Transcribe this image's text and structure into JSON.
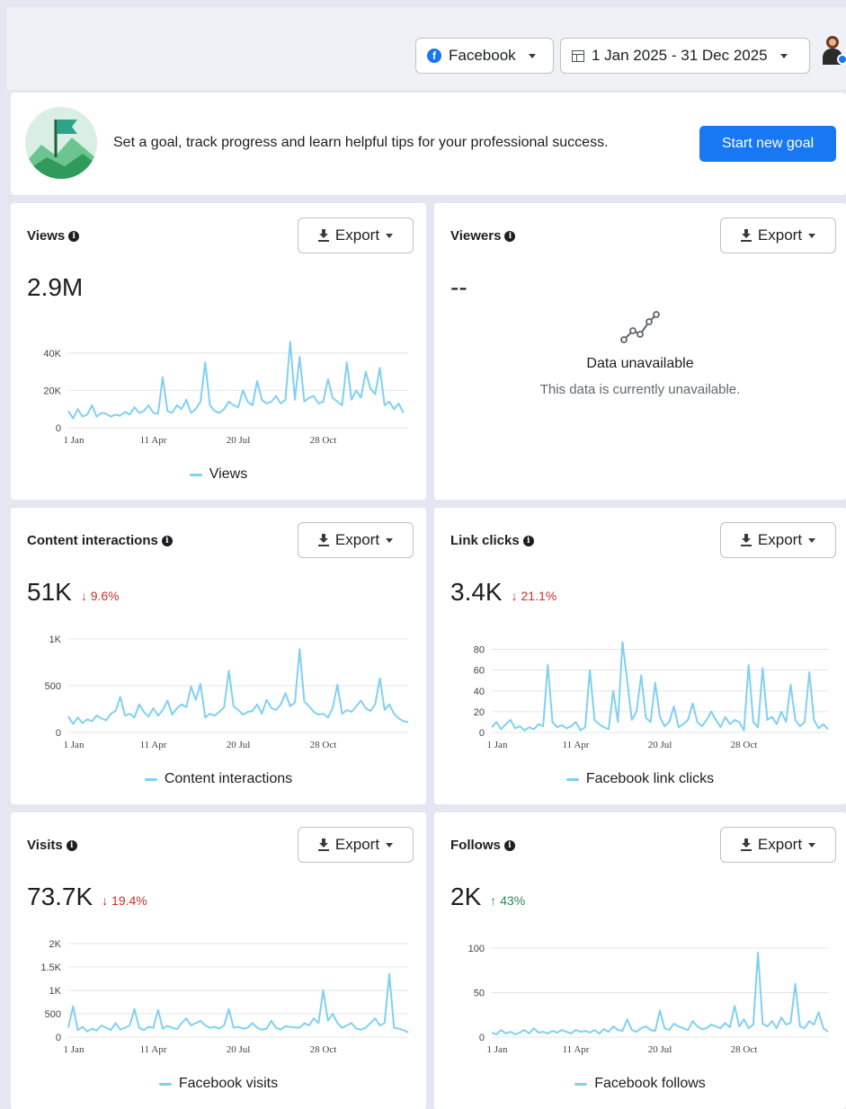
{
  "header": {
    "platform_select": "Facebook",
    "date_range": "1 Jan 2025 - 31 Dec 2025"
  },
  "banner": {
    "text": "Set a goal, track progress and learn helpful tips for your professional success.",
    "button": "Start new goal"
  },
  "export_label": "Export",
  "colors": {
    "accent": "#1877f2",
    "line": "#80d0f3",
    "negative": "#c9302c",
    "positive": "#2e8b57"
  },
  "cards": {
    "views": {
      "title": "Views",
      "value": "2.9M",
      "legend": "Views"
    },
    "viewers": {
      "title": "Viewers",
      "value": "--",
      "unavailable_title": "Data unavailable",
      "unavailable_sub": "This data is currently unavailable."
    },
    "content_interactions": {
      "title": "Content interactions",
      "value": "51K",
      "change": "↓ 9.6%",
      "legend": "Content interactions"
    },
    "link_clicks": {
      "title": "Link clicks",
      "value": "3.4K",
      "change": "↓ 21.1%",
      "legend": "Facebook link clicks"
    },
    "visits": {
      "title": "Visits",
      "value": "73.7K",
      "change": "↓ 19.4%",
      "legend": "Facebook visits"
    },
    "follows": {
      "title": "Follows",
      "value": "2K",
      "change": "↑ 43%",
      "legend": "Facebook follows"
    }
  },
  "chart_data": [
    {
      "id": "views",
      "type": "line",
      "series_name": "Views",
      "x_ticks": [
        "1 Jan",
        "11 Apr",
        "20 Jul",
        "28 Oct"
      ],
      "y_ticks": [
        "0",
        "20K",
        "40K"
      ],
      "ylim": [
        0,
        50000
      ],
      "x": [
        0,
        5,
        10,
        15,
        20,
        25,
        30,
        35,
        40,
        45,
        50,
        55,
        60,
        65,
        70,
        75,
        80,
        85,
        90,
        95,
        100,
        105,
        110,
        115,
        120,
        125,
        130,
        135,
        140,
        145,
        150,
        155,
        160,
        165,
        170,
        175,
        180,
        185,
        190,
        195,
        200,
        205,
        210,
        215,
        220,
        225,
        230,
        235,
        240,
        245,
        250,
        255,
        260,
        265,
        270,
        275,
        280,
        285,
        290,
        295,
        300,
        305,
        310,
        315,
        320,
        325,
        330,
        335,
        340,
        345,
        350,
        355,
        360
      ],
      "values": [
        9000,
        5000,
        10000,
        6000,
        7000,
        12000,
        6000,
        8000,
        7500,
        6000,
        7000,
        6500,
        8500,
        7000,
        11000,
        8000,
        9000,
        12000,
        8000,
        7500,
        27000,
        9000,
        8000,
        12000,
        10000,
        15000,
        8000,
        10000,
        14000,
        35000,
        12000,
        9000,
        8000,
        10000,
        14000,
        12000,
        11000,
        20000,
        14000,
        12000,
        25000,
        15000,
        13000,
        14000,
        17000,
        13000,
        15000,
        46000,
        15000,
        38000,
        14000,
        16000,
        17000,
        13000,
        14000,
        26000,
        16000,
        14000,
        12000,
        35000,
        15000,
        20000,
        16000,
        30000,
        21000,
        18000,
        32000,
        12000,
        14000,
        10000,
        13000,
        8000
      ]
    },
    {
      "id": "content_interactions",
      "type": "line",
      "series_name": "Content interactions",
      "x_ticks": [
        "1 Jan",
        "11 Apr",
        "20 Jul",
        "28 Oct"
      ],
      "y_ticks": [
        "0",
        "500",
        "1K"
      ],
      "ylim": [
        0,
        1000
      ],
      "x": [
        0,
        5,
        10,
        15,
        20,
        25,
        30,
        35,
        40,
        45,
        50,
        55,
        60,
        65,
        70,
        75,
        80,
        85,
        90,
        95,
        100,
        105,
        110,
        115,
        120,
        125,
        130,
        135,
        140,
        145,
        150,
        155,
        160,
        165,
        170,
        175,
        180,
        185,
        190,
        195,
        200,
        205,
        210,
        215,
        220,
        225,
        230,
        235,
        240,
        245,
        250,
        255,
        260,
        265,
        270,
        275,
        280,
        285,
        290,
        295,
        300,
        305,
        310,
        315,
        320,
        325,
        330,
        335,
        340,
        345,
        350,
        355,
        360
      ],
      "values": [
        170,
        90,
        160,
        100,
        140,
        120,
        180,
        150,
        130,
        200,
        230,
        380,
        180,
        200,
        160,
        300,
        220,
        170,
        260,
        180,
        240,
        340,
        190,
        260,
        300,
        270,
        490,
        350,
        520,
        160,
        200,
        180,
        220,
        270,
        660,
        280,
        240,
        190,
        220,
        230,
        300,
        200,
        350,
        260,
        240,
        300,
        420,
        280,
        320,
        890,
        330,
        280,
        220,
        190,
        200,
        160,
        260,
        510,
        200,
        240,
        220,
        280,
        340,
        260,
        230,
        300,
        580,
        240,
        300,
        200,
        150,
        120,
        110
      ]
    },
    {
      "id": "link_clicks",
      "type": "line",
      "series_name": "Facebook link clicks",
      "x_ticks": [
        "1 Jan",
        "11 Apr",
        "20 Jul",
        "28 Oct"
      ],
      "y_ticks": [
        "0",
        "20",
        "40",
        "60",
        "80"
      ],
      "ylim": [
        0,
        90
      ],
      "x": [
        0,
        5,
        10,
        15,
        20,
        25,
        30,
        35,
        40,
        45,
        50,
        55,
        60,
        65,
        70,
        75,
        80,
        85,
        90,
        95,
        100,
        105,
        110,
        115,
        120,
        125,
        130,
        135,
        140,
        145,
        150,
        155,
        160,
        165,
        170,
        175,
        180,
        185,
        190,
        195,
        200,
        205,
        210,
        215,
        220,
        225,
        230,
        235,
        240,
        245,
        250,
        255,
        260,
        265,
        270,
        275,
        280,
        285,
        290,
        295,
        300,
        305,
        310,
        315,
        320,
        325,
        330,
        335,
        340,
        345,
        350,
        355,
        360
      ],
      "values": [
        5,
        10,
        3,
        8,
        12,
        4,
        6,
        2,
        5,
        3,
        8,
        6,
        65,
        10,
        5,
        7,
        4,
        6,
        10,
        2,
        5,
        60,
        12,
        8,
        5,
        3,
        40,
        10,
        87,
        50,
        12,
        20,
        55,
        14,
        10,
        48,
        15,
        6,
        10,
        25,
        5,
        8,
        12,
        28,
        10,
        6,
        12,
        20,
        12,
        5,
        15,
        8,
        12,
        10,
        2,
        65,
        10,
        5,
        62,
        12,
        15,
        8,
        20,
        10,
        46,
        12,
        6,
        10,
        58,
        12,
        4,
        8,
        3
      ]
    },
    {
      "id": "visits",
      "type": "line",
      "series_name": "Facebook visits",
      "x_ticks": [
        "1 Jan",
        "11 Apr",
        "20 Jul",
        "28 Oct"
      ],
      "y_ticks": [
        "0",
        "500",
        "1K",
        "1.5K",
        "2K"
      ],
      "ylim": [
        0,
        2000
      ],
      "x": [
        0,
        5,
        10,
        15,
        20,
        25,
        30,
        35,
        40,
        45,
        50,
        55,
        60,
        65,
        70,
        75,
        80,
        85,
        90,
        95,
        100,
        105,
        110,
        115,
        120,
        125,
        130,
        135,
        140,
        145,
        150,
        155,
        160,
        165,
        170,
        175,
        180,
        185,
        190,
        195,
        200,
        205,
        210,
        215,
        220,
        225,
        230,
        235,
        240,
        245,
        250,
        255,
        260,
        265,
        270,
        275,
        280,
        285,
        290,
        295,
        300,
        305,
        310,
        315,
        320,
        325,
        330,
        335,
        340,
        345,
        350,
        355,
        360
      ],
      "values": [
        200,
        660,
        150,
        220,
        120,
        180,
        140,
        250,
        200,
        150,
        300,
        160,
        200,
        250,
        600,
        200,
        150,
        220,
        200,
        580,
        180,
        240,
        200,
        170,
        300,
        400,
        250,
        300,
        350,
        250,
        200,
        220,
        180,
        250,
        600,
        200,
        220,
        180,
        200,
        300,
        200,
        160,
        180,
        350,
        200,
        160,
        230,
        220,
        210,
        200,
        300,
        250,
        400,
        300,
        1000,
        350,
        500,
        300,
        200,
        250,
        300,
        180,
        160,
        200,
        300,
        400,
        250,
        300,
        1350,
        200,
        180,
        150,
        100
      ]
    },
    {
      "id": "follows",
      "type": "line",
      "series_name": "Facebook follows",
      "x_ticks": [
        "1 Jan",
        "11 Apr",
        "20 Jul",
        "28 Oct"
      ],
      "y_ticks": [
        "0",
        "50",
        "100"
      ],
      "ylim": [
        0,
        105
      ],
      "x": [
        0,
        5,
        10,
        15,
        20,
        25,
        30,
        35,
        40,
        45,
        50,
        55,
        60,
        65,
        70,
        75,
        80,
        85,
        90,
        95,
        100,
        105,
        110,
        115,
        120,
        125,
        130,
        135,
        140,
        145,
        150,
        155,
        160,
        165,
        170,
        175,
        180,
        185,
        190,
        195,
        200,
        205,
        210,
        215,
        220,
        225,
        230,
        235,
        240,
        245,
        250,
        255,
        260,
        265,
        270,
        275,
        280,
        285,
        290,
        295,
        300,
        305,
        310,
        315,
        320,
        325,
        330,
        335,
        340,
        345,
        350,
        355,
        360
      ],
      "values": [
        5,
        3,
        8,
        4,
        6,
        3,
        5,
        8,
        4,
        10,
        5,
        6,
        4,
        7,
        5,
        8,
        6,
        4,
        8,
        6,
        7,
        5,
        8,
        4,
        9,
        6,
        12,
        8,
        7,
        20,
        8,
        6,
        10,
        12,
        8,
        7,
        30,
        10,
        8,
        15,
        12,
        10,
        8,
        18,
        12,
        9,
        10,
        14,
        12,
        10,
        16,
        11,
        35,
        12,
        20,
        10,
        14,
        95,
        15,
        12,
        18,
        10,
        22,
        14,
        16,
        60,
        12,
        10,
        18,
        14,
        28,
        10,
        6
      ]
    }
  ]
}
